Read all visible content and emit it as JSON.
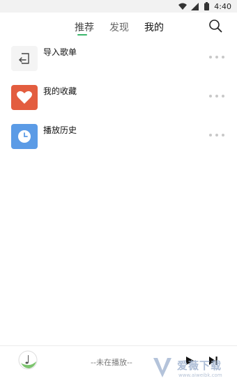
{
  "status_bar": {
    "time": "4:40",
    "icons": [
      "wifi-icon",
      "signal-icon",
      "battery-icon"
    ]
  },
  "tabs": [
    {
      "label": "推荐",
      "active": true
    },
    {
      "label": "发现",
      "active": false
    },
    {
      "label": "我的",
      "active": false
    }
  ],
  "search": {
    "icon": "search-icon"
  },
  "list": [
    {
      "label": "导入歌单",
      "icon": "import-icon",
      "color": "#f4f4f4"
    },
    {
      "label": "我的收藏",
      "icon": "heart-icon",
      "color": "#e35d3f"
    },
    {
      "label": "播放历史",
      "icon": "clock-icon",
      "color": "#5b9be6"
    }
  ],
  "player": {
    "status": "--未在播放--",
    "icons": [
      "album-cover-icon",
      "play-icon",
      "next-icon"
    ]
  },
  "watermark": {
    "text": "爱薇下载",
    "sub": "www.aiweibk.com"
  },
  "colors": {
    "accent": "#3bb56a"
  }
}
